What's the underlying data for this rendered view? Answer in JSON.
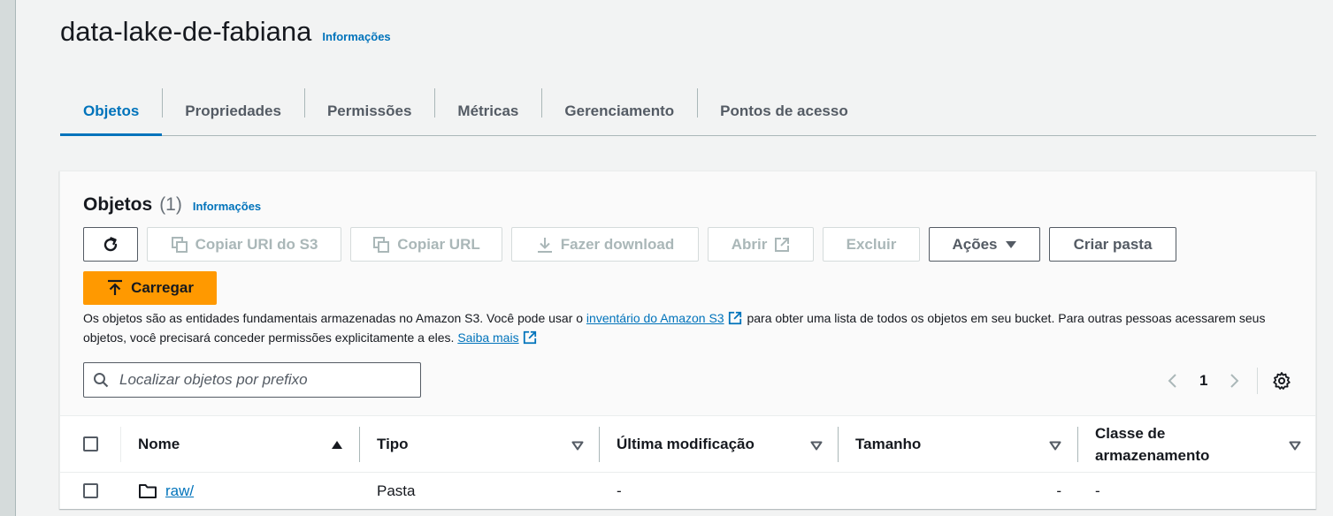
{
  "bucket": {
    "name": "data-lake-de-fabiana",
    "info_link": "Informações"
  },
  "tabs": [
    {
      "label": "Objetos",
      "active": true
    },
    {
      "label": "Propriedades"
    },
    {
      "label": "Permissões"
    },
    {
      "label": "Métricas"
    },
    {
      "label": "Gerenciamento"
    },
    {
      "label": "Pontos de acesso"
    }
  ],
  "objects_panel": {
    "title": "Objetos",
    "count": "(1)",
    "info_link": "Informações",
    "buttons": {
      "refresh_icon": "refresh-icon",
      "copy_uri": "Copiar URI do S3",
      "copy_url": "Copiar URL",
      "download": "Fazer download",
      "open": "Abrir",
      "delete": "Excluir",
      "actions": "Ações",
      "create_folder": "Criar pasta",
      "upload": "Carregar"
    },
    "description": {
      "part1": "Os objetos são as entidades fundamentais armazenadas no Amazon S3. Você pode usar o",
      "link1": "inventário do Amazon S3",
      "part2": "para obter uma lista de todos os objetos em seu bucket. Para outras pessoas acessarem seus objetos, você precisará conceder permissões explicitamente a eles.",
      "link2": "Saiba mais"
    },
    "search": {
      "placeholder": "Localizar objetos por prefixo",
      "value": ""
    },
    "pagination": {
      "current_page": "1"
    },
    "table": {
      "columns": [
        "Nome",
        "Tipo",
        "Última modificação",
        "Tamanho",
        "Classe de armazenamento"
      ],
      "sort_column": "Nome",
      "rows": [
        {
          "name": "raw/",
          "type": "Pasta",
          "last_modified": "-",
          "size": "-",
          "storage_class": "-"
        }
      ]
    }
  },
  "colors": {
    "accent": "#0073bb",
    "primary_button": "#ff9900",
    "text": "#16191f",
    "disabled": "#aab7b8"
  }
}
